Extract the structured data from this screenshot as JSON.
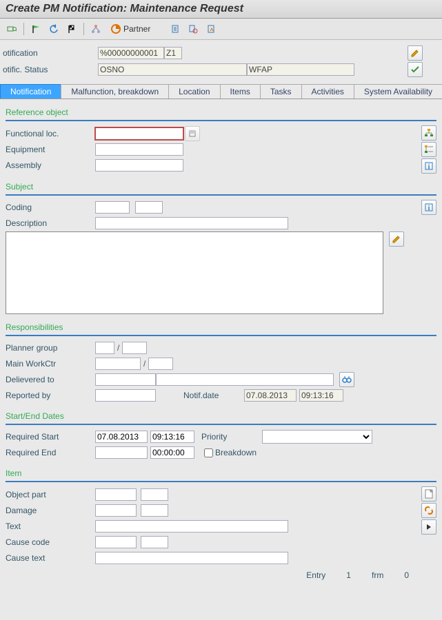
{
  "title": "Create PM Notification: Maintenance Request",
  "toolbar": {
    "partner_label": "Partner"
  },
  "header": {
    "notification_label": "otification",
    "notification_value": "%00000000001",
    "notification_type": "Z1",
    "status_label": "otific. Status",
    "status_value": "OSNO",
    "status_proc": "WFAP"
  },
  "tabs": [
    {
      "label": "Notification",
      "active": true
    },
    {
      "label": "Malfunction, breakdown",
      "active": false
    },
    {
      "label": "Location",
      "active": false
    },
    {
      "label": "Items",
      "active": false
    },
    {
      "label": "Tasks",
      "active": false
    },
    {
      "label": "Activities",
      "active": false
    },
    {
      "label": "System Availability",
      "active": false
    }
  ],
  "ref_object": {
    "title": "Reference object",
    "func_loc_label": "Functional loc.",
    "func_loc_value": "",
    "equipment_label": "Equipment",
    "equipment_value": "",
    "assembly_label": "Assembly",
    "assembly_value": ""
  },
  "subject": {
    "title": "Subject",
    "coding_label": "Coding",
    "coding_a": "",
    "coding_b": "",
    "description_label": "Description",
    "description_value": "",
    "longtext_value": ""
  },
  "resp": {
    "title": "Responsibilities",
    "planner_group_label": "Planner group",
    "planner_group_a": "",
    "planner_group_b": "",
    "workctr_label": "Main WorkCtr",
    "workctr_a": "",
    "workctr_b": "",
    "delivered_label": "Delievered to",
    "delivered_a": "",
    "delivered_b": "",
    "reported_label": "Reported by",
    "reported_value": "",
    "notif_date_label": "Notif.date",
    "notif_date": "07.08.2013",
    "notif_time": "09:13:16"
  },
  "dates": {
    "title": "Start/End Dates",
    "req_start_label": "Required Start",
    "req_start_date": "07.08.2013",
    "req_start_time": "09:13:16",
    "priority_label": "Priority",
    "priority_value": "",
    "req_end_label": "Required End",
    "req_end_date": "",
    "req_end_time": "00:00:00",
    "breakdown_label": "Breakdown",
    "breakdown_checked": false
  },
  "item": {
    "title": "Item",
    "object_part_label": "Object part",
    "damage_label": "Damage",
    "text_label": "Text",
    "cause_code_label": "Cause code",
    "cause_text_label": "Cause text",
    "entry_label": "Entry",
    "entry_num": "1",
    "frm_label": "frm",
    "frm_num": "0"
  }
}
